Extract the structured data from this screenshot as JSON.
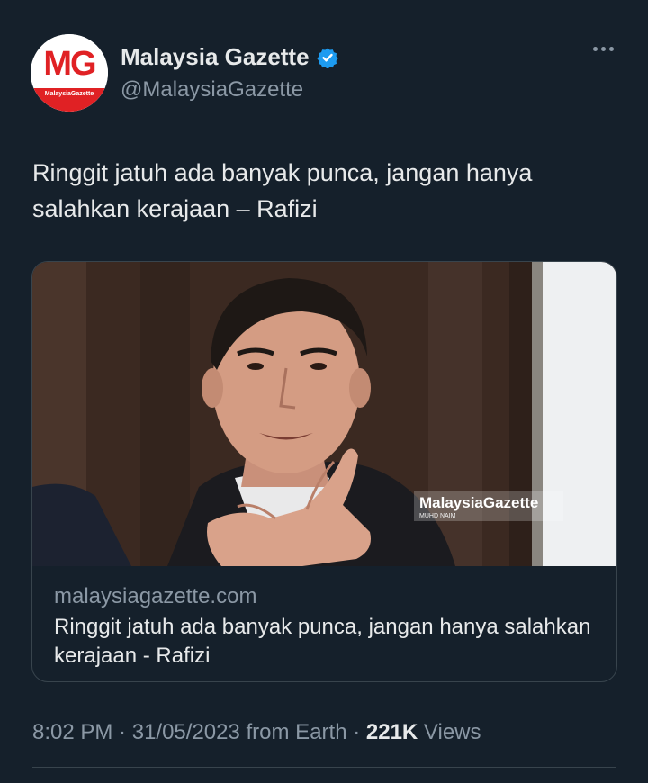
{
  "account": {
    "display_name": "Malaysia Gazette",
    "handle": "@MalaysiaGazette",
    "avatar_initials": "MG",
    "avatar_subtext": "MalaysiaGazette",
    "verified_icon": "verified-badge-icon",
    "more_icon": "more-options-icon"
  },
  "tweet": {
    "text": "Ringgit jatuh ada banyak punca, jangan hanya salahkan kerajaan – Rafizi"
  },
  "card": {
    "image_watermark": "MalaysiaGazette",
    "image_credit": "MUHD NAIM",
    "domain": "malaysiagazette.com",
    "title": "Ringgit jatuh ada banyak punca, jangan hanya salahkan kerajaan - Rafizi"
  },
  "meta": {
    "time": "8:02 PM",
    "separator1": " · ",
    "date": "31/05/2023",
    "source": " from Earth",
    "separator2": " · ",
    "views_count": "221K",
    "views_label": " Views"
  },
  "colors": {
    "background": "#15202b",
    "primary_text": "#e7e9ea",
    "secondary_text": "#8b98a5",
    "verified": "#1d9bf0",
    "brand_red": "#e02124"
  }
}
